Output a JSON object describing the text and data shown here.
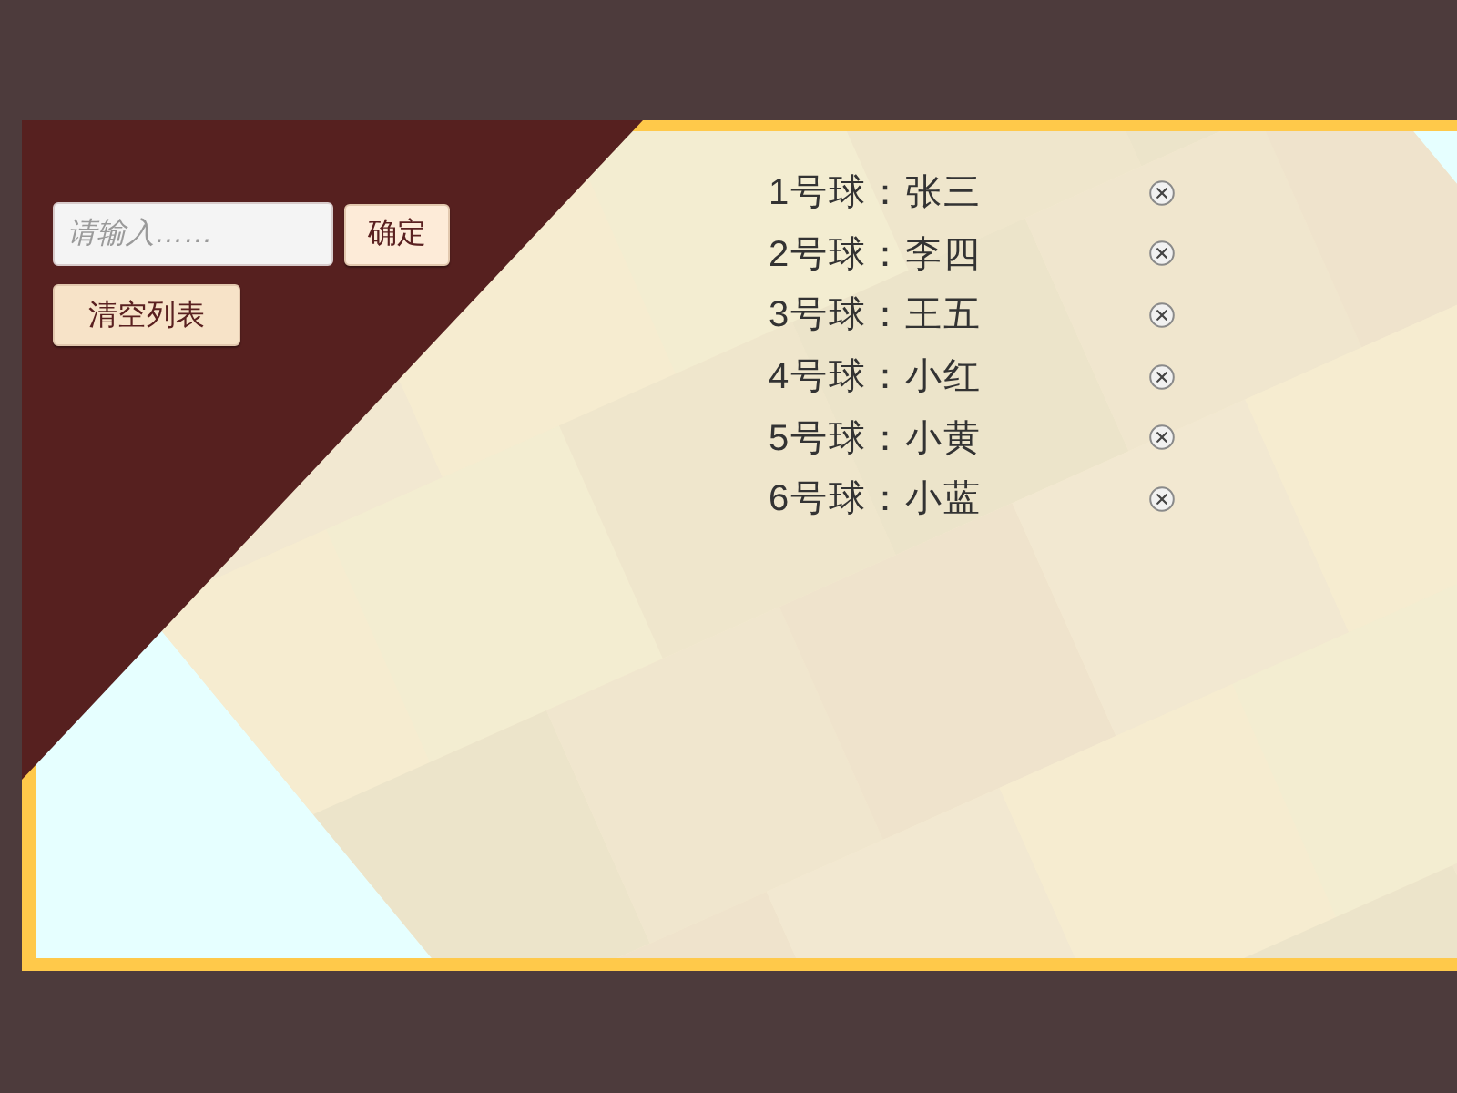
{
  "form": {
    "input": {
      "placeholder": "请输入……"
    },
    "confirm_button": {
      "label": "确定"
    },
    "clear_button": {
      "label": "清空列表"
    }
  },
  "list": [
    {
      "label": "1号球：张三"
    },
    {
      "label": "2号球：李四"
    },
    {
      "label": "3号球：王五"
    },
    {
      "label": "4号球：小红"
    },
    {
      "label": "5号球：小黄"
    },
    {
      "label": "6号球：小蓝"
    }
  ]
}
